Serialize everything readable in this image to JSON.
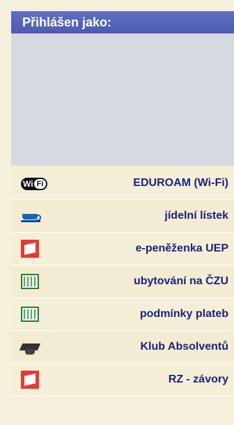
{
  "header": {
    "title": "Přihlášen jako:"
  },
  "menu": [
    {
      "label": "EDUROAM (Wi-Fi)",
      "icon": "wifi-icon"
    },
    {
      "label": "jídelní lístek",
      "icon": "coffee-cup-icon"
    },
    {
      "label": "e-peněženka UEP",
      "icon": "card-icon"
    },
    {
      "label": "ubytování na ČZU",
      "icon": "building-icon"
    },
    {
      "label": "podmínky plateb",
      "icon": "building-icon"
    },
    {
      "label": "Klub Absolventů",
      "icon": "graduation-cap-icon"
    },
    {
      "label": "RZ - závory",
      "icon": "card-icon"
    }
  ],
  "colors": {
    "header_bg": "#5c6bc0",
    "panel_bg": "#f5f0dc",
    "login_area_bg": "#d7d9e0",
    "link_text": "#1a237e"
  }
}
